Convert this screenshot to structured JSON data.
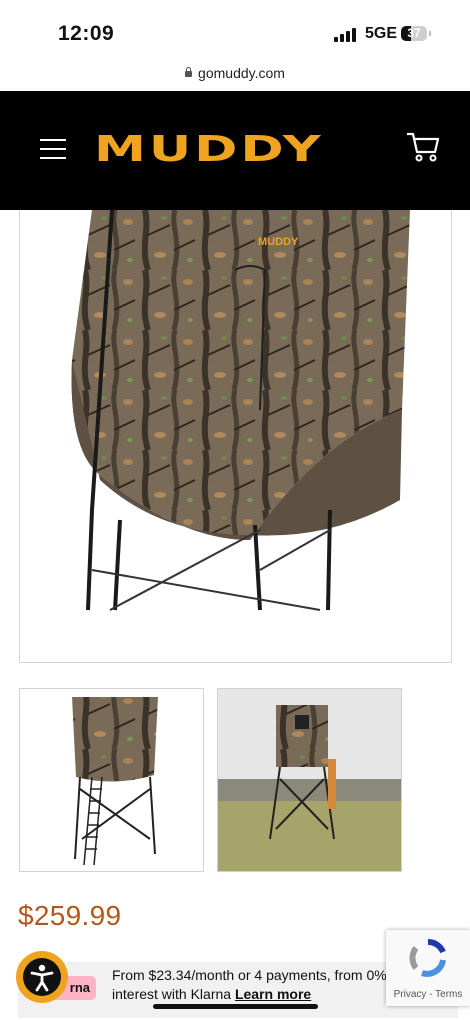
{
  "status_bar": {
    "time": "12:09",
    "network": "5GE",
    "battery": "37"
  },
  "address_bar": {
    "url": "gomuddy.com"
  },
  "header": {
    "logo": "MUDDY"
  },
  "product": {
    "price": "$259.99"
  },
  "klarna": {
    "badge": "rna",
    "message": "From $23.34/month or 4 payments, from 0% interest with Klarna",
    "learn_more": "Learn more"
  },
  "recaptcha": {
    "privacy": "Privacy",
    "separator": " - ",
    "terms": "Terms"
  },
  "colors": {
    "brand_orange": "#f0a31f",
    "price": "#b3571c",
    "header_bg": "#000000",
    "klarna_pink": "#ffb3c7"
  }
}
